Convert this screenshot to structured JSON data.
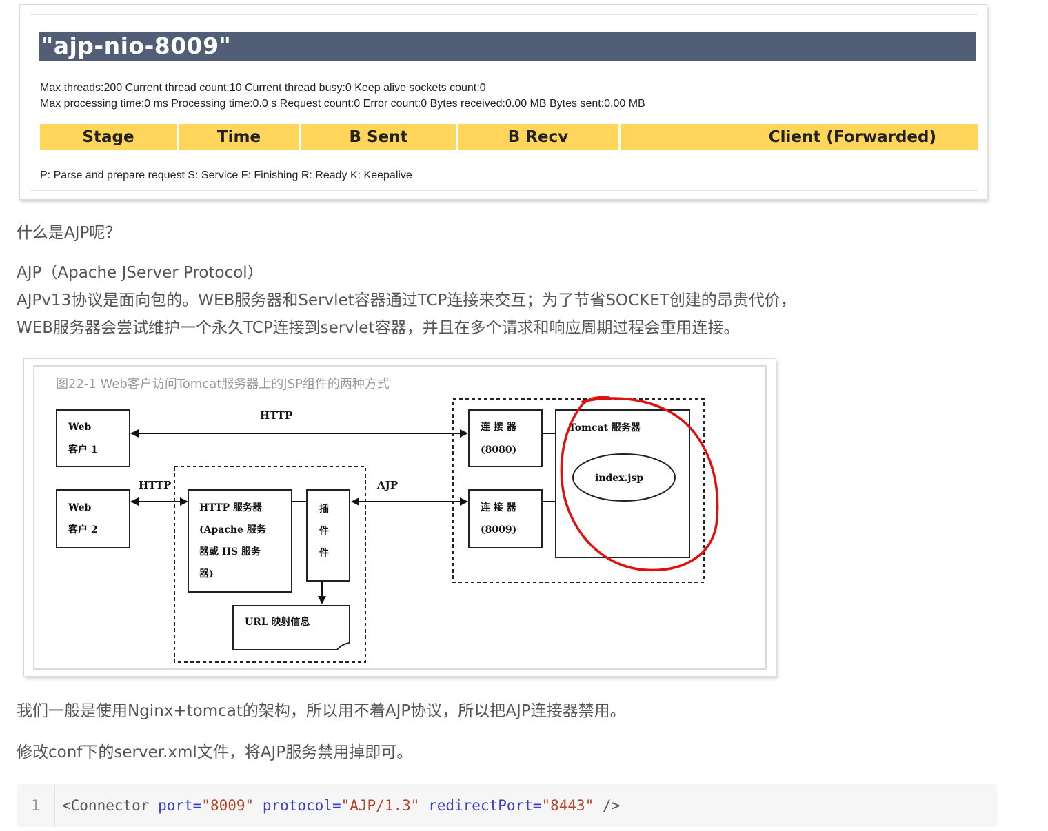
{
  "status": {
    "connector_name": "\"ajp-nio-8009\"",
    "stats_line1": "Max threads:200 Current thread count:10 Current thread busy:0 Keep alive sockets count:0",
    "stats_line2": "Max processing time:0 ms Processing time:0.0 s Request count:0 Error count:0 Bytes received:0.00 MB Bytes sent:0.00 MB",
    "columns": [
      "Stage",
      "Time",
      "B Sent",
      "B Recv",
      "Client (Forwarded)"
    ],
    "legend": "P: Parse and prepare request S: Service F: Finishing R: Ready K: Keepalive"
  },
  "article": {
    "q_heading": "什么是AJP呢？",
    "ajp_full": "AJP（Apache JServer Protocol）",
    "ajp_desc_1": "AJPv13协议是面向包的。WEB服务器和Servlet容器通过TCP连接来交互；为了节省SOCKET创建的昂贵代价，",
    "ajp_desc_2": "WEB服务器会尝试维护一个永久TCP连接到servlet容器，并且在多个请求和响应周期过程会重用连接。",
    "nginx_note": "我们一般是使用Nginx+tomcat的架构，所以用不着AJP协议，所以把AJP连接器禁用。",
    "modify_note": "修改conf下的server.xml文件，将AJP服务禁用掉即可。"
  },
  "figure": {
    "caption": "图22-1 Web客户访问Tomcat服务器上的JSP组件的两种方式",
    "client1_line1": "Web",
    "client1_line2": "客户 1",
    "client2_line1": "Web",
    "client2_line2": "客户 2",
    "http_top": "HTTP",
    "http_left": "HTTP",
    "ajp": "AJP",
    "http_server_lines": [
      "HTTP 服务器",
      "(Apache 服务",
      "器或 IIS 服务",
      "器)"
    ],
    "plugin_lines": [
      "插",
      "件",
      "件"
    ],
    "url_map": "URL 映射信息",
    "connector1_line1": "连 接 器",
    "connector1_line2": "(8080)",
    "connector2_line1": "连 接 器",
    "connector2_line2": "(8009)",
    "tomcat": "Tomcat 服务器",
    "jsp": "index.jsp",
    "highlight_color": "#e01010"
  },
  "code": {
    "line_number": "1",
    "open": "<Connector ",
    "attr1": "port=",
    "val1": "\"8009\"",
    "attr2": "protocol=",
    "val2": "\"AJP/1.3\"",
    "attr3": "redirectPort=",
    "val3": "\"8443\"",
    "close": " />"
  },
  "colors": {
    "title_bar": "#525d76",
    "table_header": "#ffd659",
    "code_attr": "#3a3fc9",
    "code_string": "#b5452b"
  }
}
